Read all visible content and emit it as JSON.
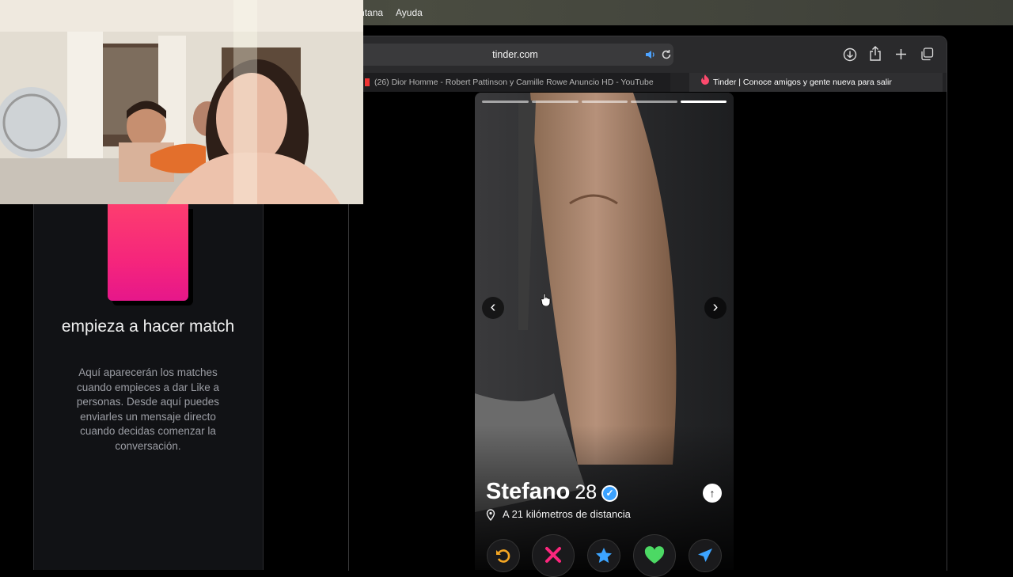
{
  "menubar": {
    "items": [
      "Ventana",
      "Ayuda"
    ]
  },
  "browser": {
    "url": "tinder.com",
    "tabs": [
      {
        "label": "(26) Dior Homme - Robert Pattinson y Camille Rowe Anuncio HD - YouTube",
        "active": false
      },
      {
        "label": "Tinder | Conoce amigos y gente nueva para salir",
        "active": true
      }
    ]
  },
  "sidebar": {
    "title": "empieza a hacer match",
    "description": "Aquí aparecerán los matches cuando empieces a dar Like a personas. Desde aquí puedes enviarles un mensaje directo cuando decidas comenzar la conversación."
  },
  "profile": {
    "name": "Stefano",
    "age": "28",
    "distance": "A 21 kilómetros de distancia",
    "photo_count": 5,
    "active_photo": 5
  },
  "actions": [
    {
      "name": "rewind-button",
      "icon": "rewind-icon",
      "color": "#f5a623"
    },
    {
      "name": "nope-button",
      "icon": "close-icon",
      "color": "#fd267d"
    },
    {
      "name": "super-like-button",
      "icon": "star-icon",
      "color": "#3ca4ff"
    },
    {
      "name": "like-button",
      "icon": "heart-icon",
      "color": "#4cd964"
    },
    {
      "name": "boost-button",
      "icon": "send-icon",
      "color": "#3ca4ff"
    }
  ],
  "colors": {
    "brand_gradient_start": "#fd3d6f",
    "brand_gradient_end": "#e6178a",
    "verified": "#3ba2ff"
  }
}
